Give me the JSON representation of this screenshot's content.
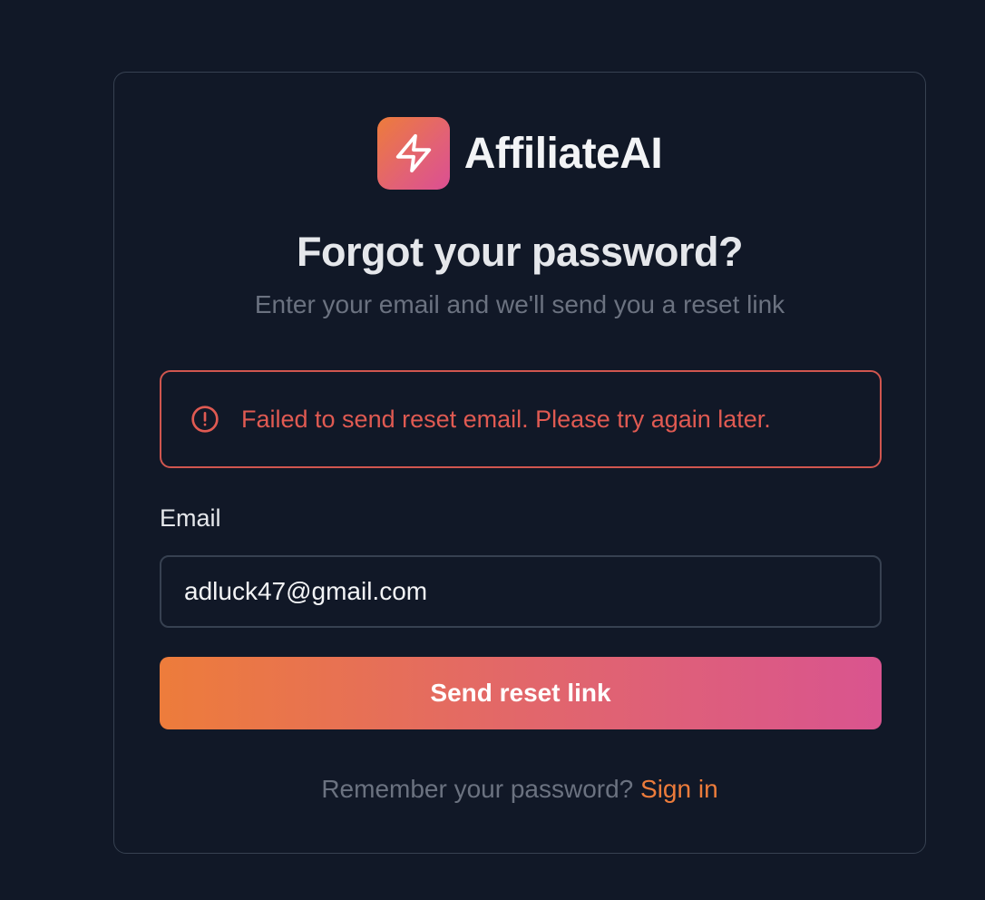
{
  "brand": {
    "name": "AffiliateAI",
    "logo_icon": "lightning-bolt-icon",
    "logo_gradient": [
      "#ed7c3b",
      "#db4f93"
    ]
  },
  "heading": {
    "title": "Forgot your password?",
    "subtitle": "Enter your email and we'll send you a reset link"
  },
  "alert": {
    "icon": "alert-circle-icon",
    "message": "Failed to send reset email. Please try again later.",
    "color": "#e05a52"
  },
  "form": {
    "email_label": "Email",
    "email_value": "adluck47@gmail.com",
    "submit_label": "Send reset link"
  },
  "footer": {
    "prompt": "Remember your password?",
    "link_label": "Sign in",
    "link_color": "#ed7c3b"
  },
  "colors": {
    "background": "#111827",
    "border": "#374151",
    "text_primary": "#e5e7eb",
    "text_muted": "#6b7280"
  }
}
